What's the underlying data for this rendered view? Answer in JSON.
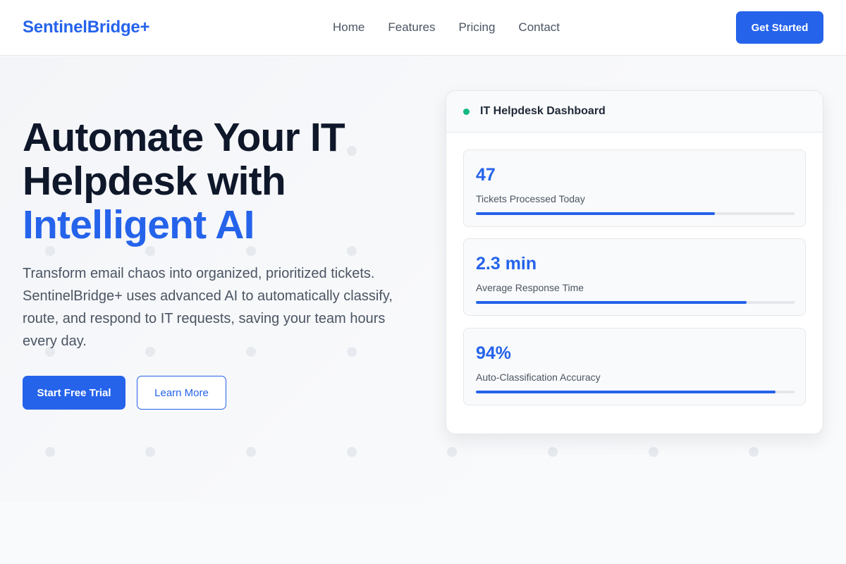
{
  "brand": {
    "name": "SentinelBridge+",
    "accent": "#2563eb"
  },
  "nav": {
    "items": [
      {
        "label": "Home"
      },
      {
        "label": "Features"
      },
      {
        "label": "Pricing"
      },
      {
        "label": "Contact"
      }
    ],
    "cta_label": "Get Started"
  },
  "hero": {
    "title_line1": "Automate Your IT",
    "title_line2": "Helpdesk with",
    "title_accent": "Intelligent AI",
    "description": "Transform email chaos into organized, prioritized tickets. SentinelBridge+ uses advanced AI to automatically classify, route, and respond to IT requests, saving your team hours every day.",
    "primary_cta": "Start Free Trial",
    "secondary_cta": "Learn More"
  },
  "dashboard": {
    "title": "IT Helpdesk Dashboard",
    "status_color": "#10b981",
    "metrics": [
      {
        "value": "47",
        "label": "Tickets Processed Today",
        "progress": 0.75
      },
      {
        "value": "2.3 min",
        "label": "Average Response Time",
        "progress": 0.85
      },
      {
        "value": "94%",
        "label": "Auto-Classification Accuracy",
        "progress": 0.94
      }
    ]
  }
}
